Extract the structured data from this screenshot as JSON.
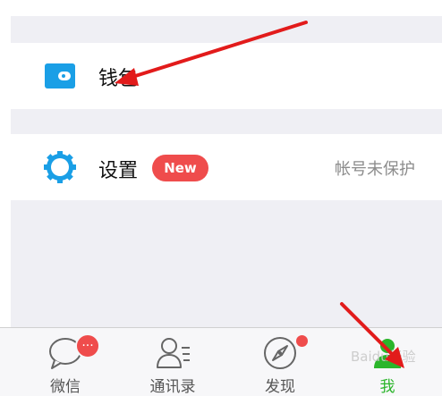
{
  "menu": {
    "wallet": {
      "label": "钱包",
      "icon": "wallet-icon"
    },
    "settings": {
      "label": "设置",
      "icon": "gear-icon",
      "badge": "New",
      "status": "帐号未保护"
    }
  },
  "tabbar": {
    "tabs": [
      {
        "label": "微信",
        "icon": "chat-bubble-icon",
        "badge": "···"
      },
      {
        "label": "通讯录",
        "icon": "contacts-icon"
      },
      {
        "label": "发现",
        "icon": "compass-icon"
      },
      {
        "label": "我",
        "icon": "person-icon",
        "active": true
      }
    ]
  },
  "watermark": {
    "text": "Baidu经验"
  },
  "colors": {
    "accent_green": "#2bb52b",
    "badge_red": "#ef4c4c",
    "icon_blue": "#1a9fe6",
    "arrow_red": "#e21b1b"
  }
}
